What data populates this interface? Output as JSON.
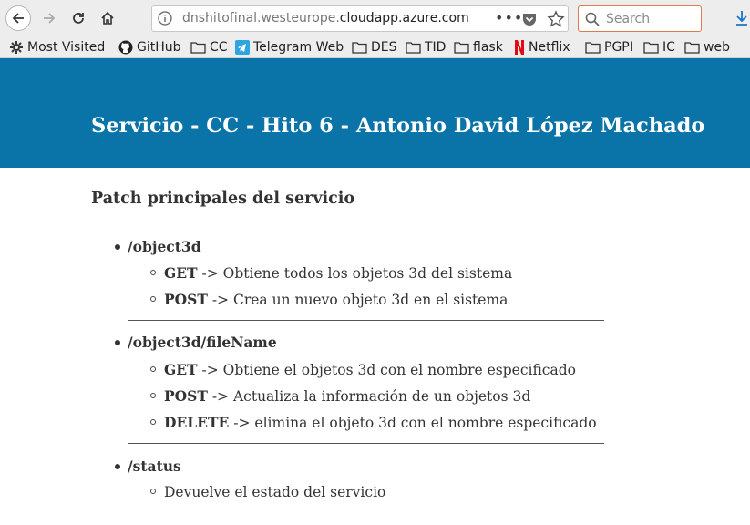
{
  "browser": {
    "url_prefix": "dnshitofinal.westeurope.",
    "url_domain": "cloudapp.azure.com",
    "search_placeholder": "Search",
    "bookmarks": [
      {
        "label": "Most Visited",
        "icon": "gear-icon"
      },
      {
        "label": "GitHub",
        "icon": "github-icon"
      },
      {
        "label": "CC",
        "icon": "folder-icon"
      },
      {
        "label": "Telegram Web",
        "icon": "telegram-icon"
      },
      {
        "label": "DES",
        "icon": "folder-icon"
      },
      {
        "label": "TID",
        "icon": "folder-icon"
      },
      {
        "label": "flask",
        "icon": "folder-icon"
      },
      {
        "label": "Netflix",
        "icon": "netflix-icon"
      },
      {
        "label": "PGPI",
        "icon": "folder-icon"
      },
      {
        "label": "IC",
        "icon": "folder-icon"
      },
      {
        "label": "web",
        "icon": "folder-icon"
      }
    ]
  },
  "page": {
    "title": "Servicio - CC - Hito 6 - Antonio David López Machado",
    "section_title": "Patch principales del servicio",
    "endpoints": [
      {
        "path": "/object3d",
        "items": [
          {
            "method": "GET",
            "desc": " -> Obtiene todos los objetos 3d del sistema"
          },
          {
            "method": "POST",
            "desc": " -> Crea un nuevo objeto 3d en el sistema"
          }
        ]
      },
      {
        "path": "/object3d/fileName",
        "items": [
          {
            "method": "GET",
            "desc": " -> Obtiene el objetos 3d con el nombre especificado"
          },
          {
            "method": "POST",
            "desc": " -> Actualiza la información de un objetos 3d"
          },
          {
            "method": "DELETE",
            "desc": " -> elimina el objeto 3d con el nombre especificado"
          }
        ]
      },
      {
        "path": "/status",
        "items": [
          {
            "method": "",
            "desc": "Devuelve el estado del servicio"
          }
        ]
      }
    ]
  },
  "colors": {
    "banner": "#0a73a8",
    "chrome": "#ededed",
    "text": "#333333"
  }
}
